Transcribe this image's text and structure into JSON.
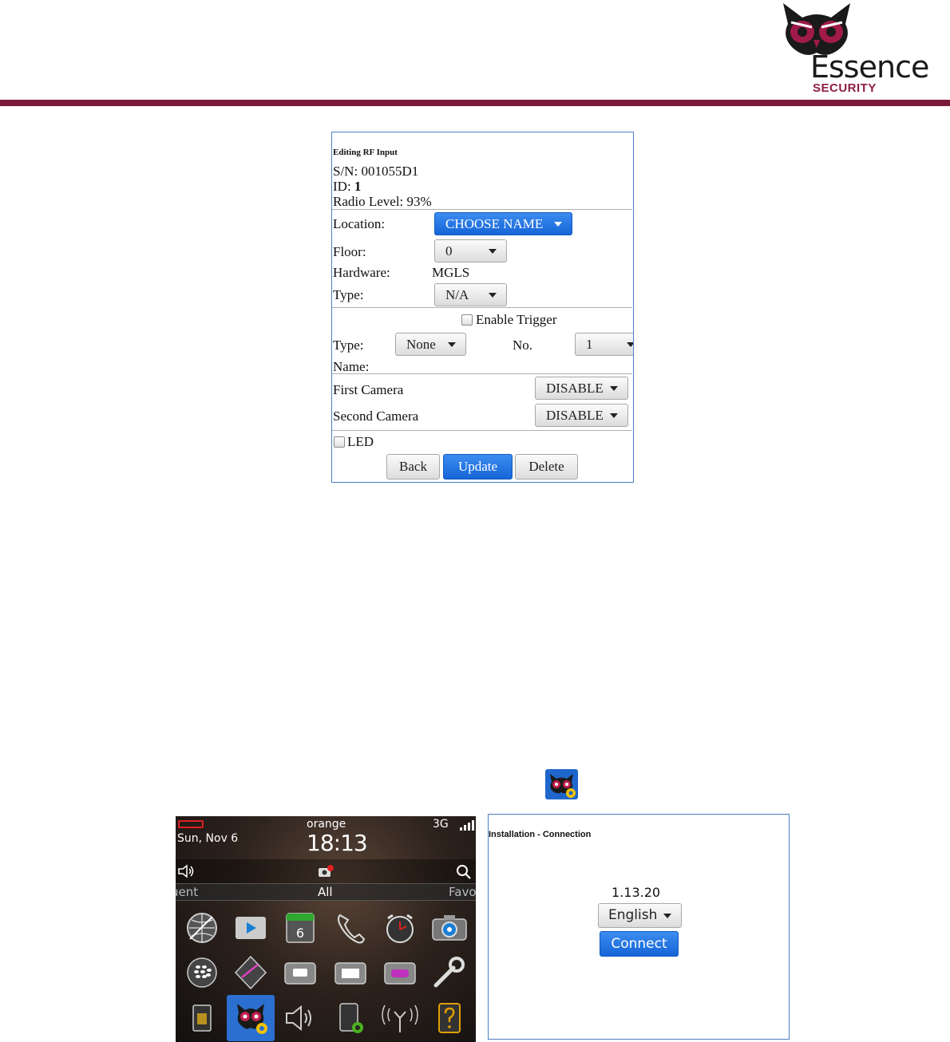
{
  "brand": {
    "logo_word": "Essence",
    "logo_sub": "SECURITY",
    "accent_color": "#7a1a3a",
    "logo_icon": "owl-logo-icon"
  },
  "rf_input": {
    "title": "Editing RF Input",
    "sn_label": "S/N:",
    "sn_value": "001055D1",
    "id_label": "ID:",
    "id_value": "1",
    "radio_label": "Radio Level:",
    "radio_value": "93%",
    "location_label": "Location:",
    "location_value": "CHOOSE NAME",
    "floor_label": "Floor:",
    "floor_value": "0",
    "hardware_label": "Hardware:",
    "hardware_value": "MGLS",
    "type_label": "Type:",
    "type_value": "N/A",
    "enable_trigger_label": "Enable Trigger",
    "trigger_type_label": "Type:",
    "trigger_type_value": "None",
    "no_label": "No.",
    "no_value": "1",
    "name_label": "Name:",
    "first_camera_label": "First Camera",
    "first_camera_value": "DISABLE",
    "second_camera_label": "Second Camera",
    "second_camera_value": "DISABLE",
    "led_label": "LED",
    "back_label": "Back",
    "update_label": "Update",
    "delete_label": "Delete",
    "primary_color": "#1f6fe0"
  },
  "phone": {
    "date": "Sun, Nov 6",
    "carrier": "orange",
    "time": "18:13",
    "network": "3G",
    "tab_left": "uent",
    "tab_center": "All",
    "tab_right": "Favo",
    "apps": [
      "browser-icon",
      "media-icon",
      "calendar-icon",
      "phone-icon",
      "clock-icon",
      "camera-icon",
      "blackberry-icon",
      "maps-icon",
      "messages-icon",
      "files-icon",
      "games-icon",
      "options-icon",
      "sim-icon",
      "essence-app-icon",
      "sound-icon",
      "setup-icon",
      "network-icon",
      "help-icon"
    ],
    "calendar_day": "6"
  },
  "connection": {
    "title": "Installation - Connection",
    "version": "1.13.20",
    "language": "English",
    "connect_label": "Connect"
  }
}
